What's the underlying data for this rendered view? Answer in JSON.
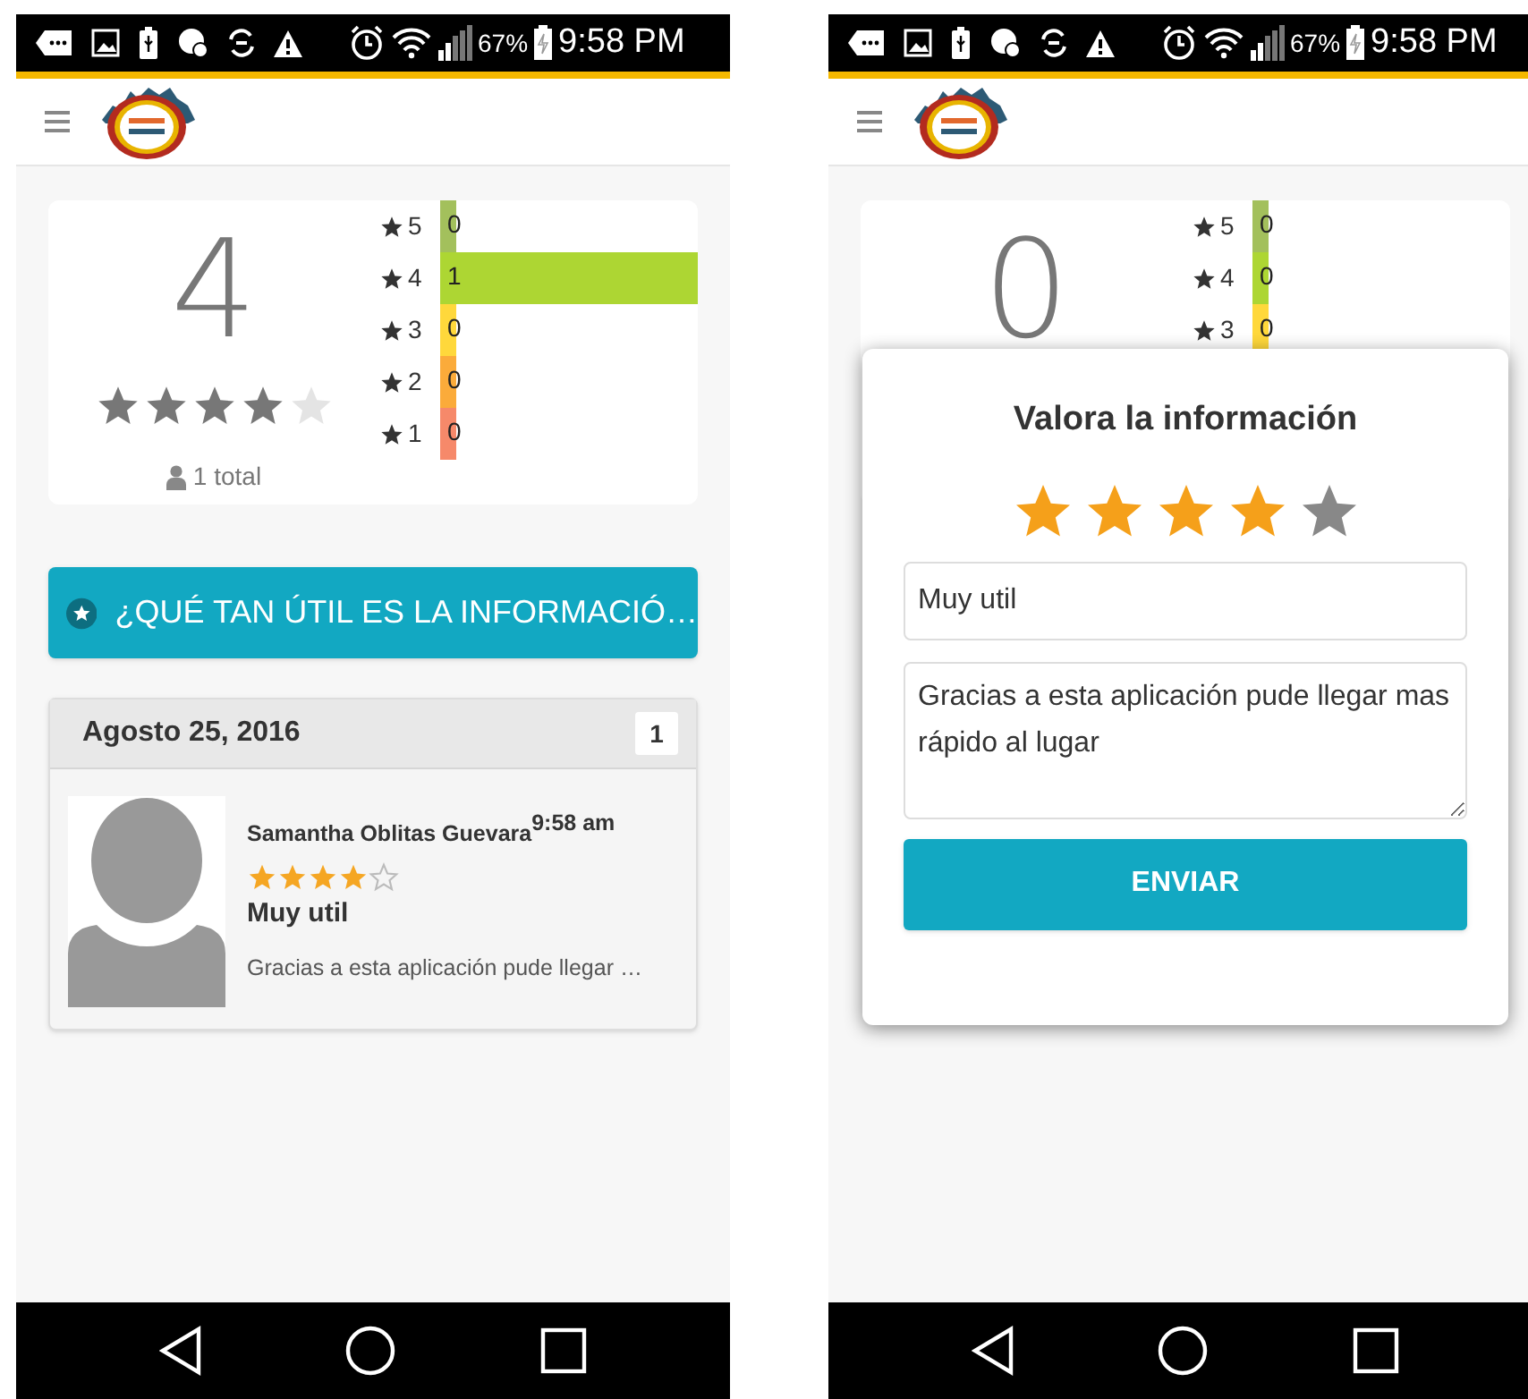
{
  "phones": [
    {
      "status_bar": {
        "battery": "67%",
        "time": "9:58 PM"
      },
      "summary": {
        "average": "4",
        "stars": 4,
        "total": "1 total",
        "distribution": [
          {
            "label": "5",
            "count": "0",
            "kind": "stub",
            "color": "#a3c05c"
          },
          {
            "label": "4",
            "count": "1",
            "kind": "full",
            "color": "#add633"
          },
          {
            "label": "3",
            "count": "0",
            "kind": "stub",
            "color": "#ffd83b"
          },
          {
            "label": "2",
            "count": "0",
            "kind": "stub",
            "color": "#fbab3a"
          },
          {
            "label": "1",
            "count": "0",
            "kind": "stub",
            "color": "#f6896a"
          }
        ]
      },
      "question_button": {
        "label": "¿QUÉ TAN ÚTIL ES LA INFORMACIÓ…"
      },
      "reviews": [
        {
          "date": "Agosto 25, 2016",
          "count": "1",
          "author": "Samantha Oblitas Guevara",
          "time": "9:58 am",
          "stars": 4,
          "title": "Muy util",
          "text": "Gracias a esta aplicación pude llegar …"
        }
      ]
    },
    {
      "status_bar": {
        "battery": "67%",
        "time": "9:58 PM"
      },
      "summary": {
        "average": "0",
        "distribution": [
          {
            "label": "5",
            "count": "0",
            "kind": "stub",
            "color": "#a3c05c"
          },
          {
            "label": "4",
            "count": "0",
            "kind": "stub",
            "color": "#add633"
          },
          {
            "label": "3",
            "count": "0",
            "kind": "stub",
            "color": "#ffd83b"
          }
        ]
      },
      "dialog": {
        "title": "Valora la información",
        "stars": 4,
        "title_value": "Muy util",
        "comment": "Gracias a esta aplicación pude llegar mas rápido al lugar",
        "button": "ENVIAR"
      }
    }
  ]
}
